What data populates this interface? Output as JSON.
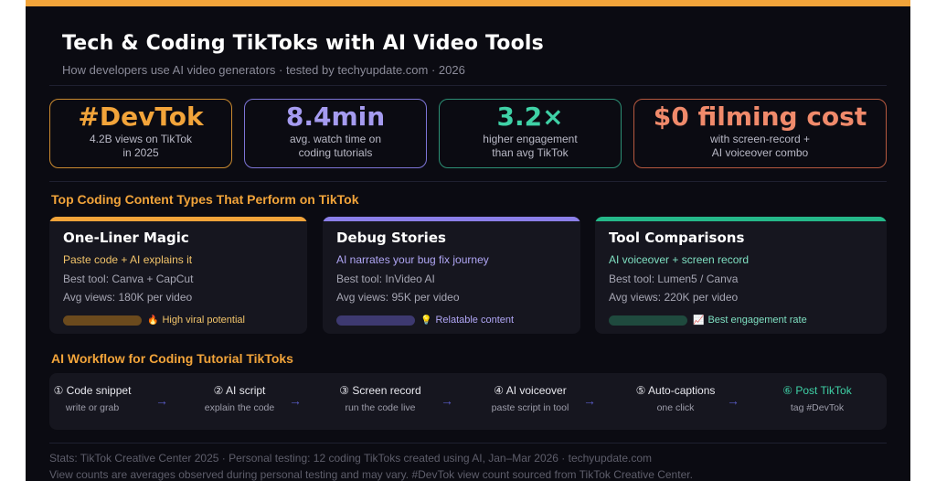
{
  "header": {
    "title": "Tech & Coding TikToks with AI Video Tools",
    "subtitle": "How developers use AI video generators · tested by techyupdate.com · 2026"
  },
  "stats": [
    {
      "value": "#DevTok",
      "desc": "4.2B views on TikTok\nin 2025",
      "color": "#f2a43a",
      "border": "#c9892f"
    },
    {
      "value": "8.4min",
      "desc": "avg. watch time on\ncoding tutorials",
      "color": "#a59bf0",
      "border": "#7d74d6"
    },
    {
      "value": "3.2×",
      "desc": "higher engagement\nthan avg TikTok",
      "color": "#3fd1a6",
      "border": "#2c8f74"
    },
    {
      "value": "$0 filming cost",
      "desc": "with screen-record +\nAI voiceover combo",
      "color": "#f08a6b",
      "border": "#b5583f"
    }
  ],
  "content_section": {
    "title": "Top Coding Content Types That Perform on TikTok"
  },
  "cards": [
    {
      "title": "One-Liner Magic",
      "tagline": "Paste code + AI explains it",
      "tool": "Best tool: Canva + CapCut",
      "views": "Avg views: 180K per video",
      "badge_icon": "fire-icon",
      "badge": "High viral potential",
      "accent": "#f2a43a",
      "meter_color": "#6b4a1d",
      "tag_color": "#f2c46a"
    },
    {
      "title": "Debug Stories",
      "tagline": "AI narrates your bug fix journey",
      "tool": "Best tool: InVideo AI",
      "views": "Avg views: 95K per video",
      "badge_icon": "lightbulb-icon",
      "badge": "Relatable content",
      "accent": "#8b7fe8",
      "meter_color": "#3d3970",
      "tag_color": "#b0a6f5"
    },
    {
      "title": "Tool Comparisons",
      "tagline": "AI voiceover + screen record",
      "tool": "Best tool: Lumen5 / Canva",
      "views": "Avg views: 220K per video",
      "badge_icon": "chart-icon",
      "badge": "Best engagement rate",
      "accent": "#25b889",
      "meter_color": "#1f4a3e",
      "tag_color": "#7fe0c2"
    }
  ],
  "workflow_section": {
    "title": "AI Workflow for Coding Tutorial TikToks"
  },
  "workflow": [
    {
      "label": "① Code snippet",
      "desc": "write or grab"
    },
    {
      "label": "② AI script",
      "desc": "explain the code"
    },
    {
      "label": "③ Screen record",
      "desc": "run the code live"
    },
    {
      "label": "④ AI voiceover",
      "desc": "paste script in tool"
    },
    {
      "label": "⑤ Auto-captions",
      "desc": "one click"
    },
    {
      "label": "⑥ Post TikTok",
      "desc": "tag #DevTok",
      "color": "#3fd1a6"
    }
  ],
  "footer": {
    "line1": "Stats: TikTok Creative Center 2025 · Personal testing: 12 coding TikToks created using AI, Jan–Mar 2026 · techyupdate.com",
    "line2": "View counts are averages observed during personal testing and may vary. #DevTok view count sourced from TikTok Creative Center."
  }
}
